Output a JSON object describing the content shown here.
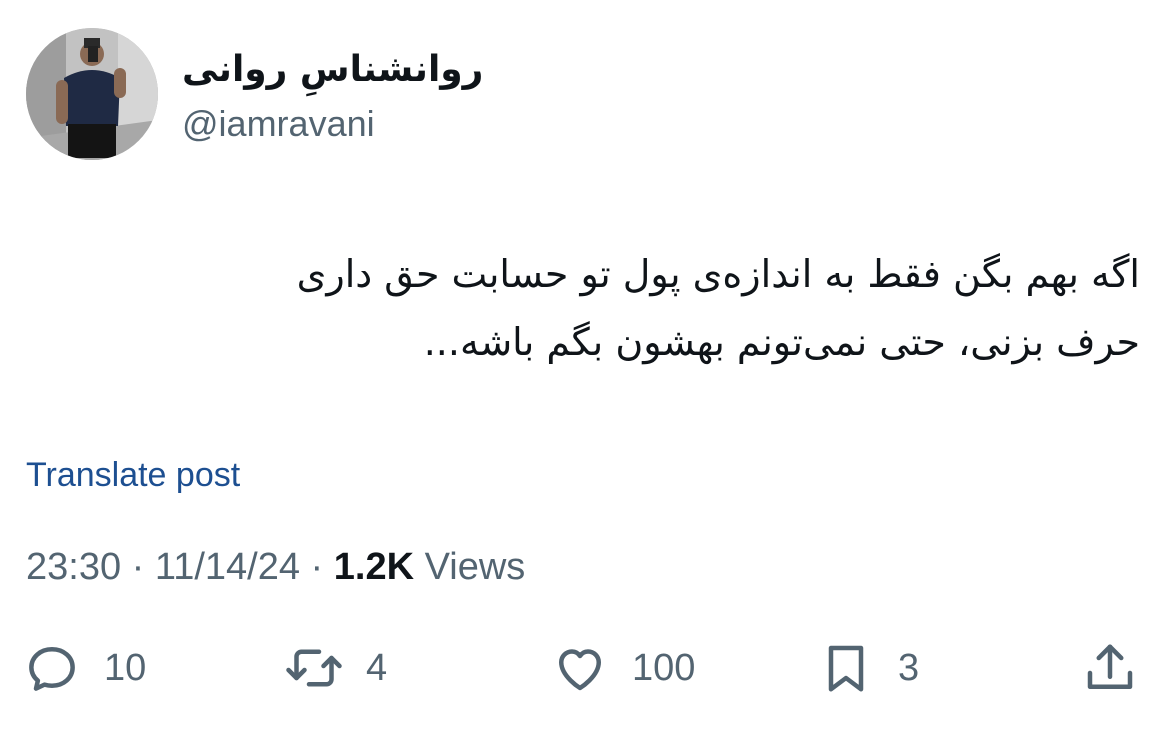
{
  "author": {
    "display_name": "روانشناسِ روانی",
    "handle": "@iamravani"
  },
  "tweet": {
    "lines": [
      "اگه بهم بگن فقط به اندازه‌ی پول تو حسابت حق داری",
      "حرف بزنی، حتی نمی‌تونم بهشون بگم باشه..."
    ],
    "translate_label": "Translate post"
  },
  "meta": {
    "time": "23:30",
    "separator": "·",
    "date": "11/14/24",
    "views_count": "1.2K",
    "views_label": "Views"
  },
  "actions": {
    "reply": {
      "icon": "reply-icon",
      "count": "10"
    },
    "retweet": {
      "icon": "retweet-icon",
      "count": "4"
    },
    "like": {
      "icon": "heart-icon",
      "count": "100"
    },
    "bookmark": {
      "icon": "bookmark-icon",
      "count": "3"
    },
    "share": {
      "icon": "share-icon"
    }
  },
  "colors": {
    "text": "#0f1419",
    "muted": "#536471",
    "link": "#1d4f91"
  }
}
